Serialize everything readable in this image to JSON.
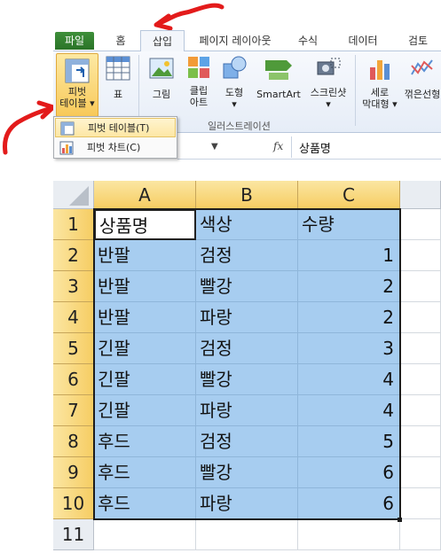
{
  "ribbon_tabs": [
    {
      "label": "파일"
    },
    {
      "label": "홈"
    },
    {
      "label": "삽입"
    },
    {
      "label": "페이지 레이아웃"
    },
    {
      "label": "수식"
    },
    {
      "label": "데이터"
    },
    {
      "label": "검토"
    }
  ],
  "ribbon": {
    "pivot_table_label_1": "피벗",
    "pivot_table_label_2": "테이블 ▾",
    "table_label": "표",
    "picture_label": "그림",
    "clipart_label_1": "클립",
    "clipart_label_2": "아트",
    "shapes_label_1": "도형",
    "shapes_label_2": "▾",
    "smartart_label": "SmartArt",
    "screenshot_label_1": "스크린샷",
    "screenshot_label_2": "▾",
    "column_chart_label_1": "세로",
    "column_chart_label_2": "막대형 ▾",
    "line_chart_label": "꺾은선형",
    "illustrations_group": "일러스트레이션"
  },
  "dropdown": {
    "pivot_table_item": "피벗 테이블(T)",
    "pivot_chart_item": "피벗 차트(C)"
  },
  "formula_bar": {
    "dropdown_glyph": "▼",
    "fx": "fx",
    "content": "상품명"
  },
  "columns": [
    "A",
    "B",
    "C"
  ],
  "rows": [
    {
      "n": "1",
      "a": "상품명",
      "b": "색상",
      "c": "수량"
    },
    {
      "n": "2",
      "a": "반팔",
      "b": "검정",
      "c": "1"
    },
    {
      "n": "3",
      "a": "반팔",
      "b": "빨강",
      "c": "2"
    },
    {
      "n": "4",
      "a": "반팔",
      "b": "파랑",
      "c": "2"
    },
    {
      "n": "5",
      "a": "긴팔",
      "b": "검정",
      "c": "3"
    },
    {
      "n": "6",
      "a": "긴팔",
      "b": "빨강",
      "c": "4"
    },
    {
      "n": "7",
      "a": "긴팔",
      "b": "파랑",
      "c": "4"
    },
    {
      "n": "8",
      "a": "후드",
      "b": "검정",
      "c": "5"
    },
    {
      "n": "9",
      "a": "후드",
      "b": "빨강",
      "c": "6"
    },
    {
      "n": "10",
      "a": "후드",
      "b": "파랑",
      "c": "6"
    },
    {
      "n": "11",
      "a": "",
      "b": "",
      "c": ""
    }
  ],
  "colors": {
    "selection": "#a7cdf0",
    "header_highlight": "#f6cd63",
    "annotation_red": "#e31b1b",
    "file_tab": "#2b7428"
  }
}
